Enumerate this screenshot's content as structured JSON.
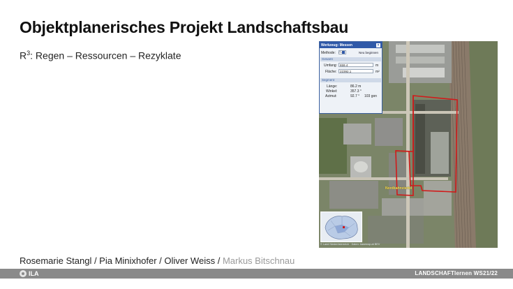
{
  "slide": {
    "title": "Objektplanerisches Projekt Landschaftsbau",
    "subtitle_prefix": "R",
    "subtitle_sup": "3",
    "subtitle_rest": ": Regen – Ressourcen – Rezyklate",
    "authors": "Rosemarie Stangl / Pia Minixhofer / Oliver Weiss /",
    "authors_muted": "Markus Bitschnau"
  },
  "footer": {
    "logo_text": "ILA",
    "course": "LANDSCHAFTlernen WS21/22"
  },
  "map": {
    "label": "Nordbahnviertel",
    "copyright": "© Land Niederösterreich · Daten: basemap.at BEV",
    "outline_color": "#d11a1a",
    "panel": {
      "title": "Werkzeug: Messen",
      "close": "×",
      "methode_label": "Methode:",
      "methode_icon": "∕∿",
      "neu_beginnen": "Neu beginnen",
      "gesamt": "Gesamt",
      "umfang_label": "Umfang:",
      "umfang_value": "659.4",
      "umfang_unit": "m",
      "flaeche_label": "Fläche:",
      "flaeche_value": "22392.1",
      "flaeche_unit": "m²",
      "segment": "Segment",
      "laenge_label": "Länge:",
      "laenge_value": "86.2 m",
      "winkel_label": "Winkel:",
      "winkel_value": "357.3 °",
      "azimut_label": "Azimut:",
      "azimut_value": "92.7 °",
      "azimut_gon": "103 gon"
    }
  }
}
